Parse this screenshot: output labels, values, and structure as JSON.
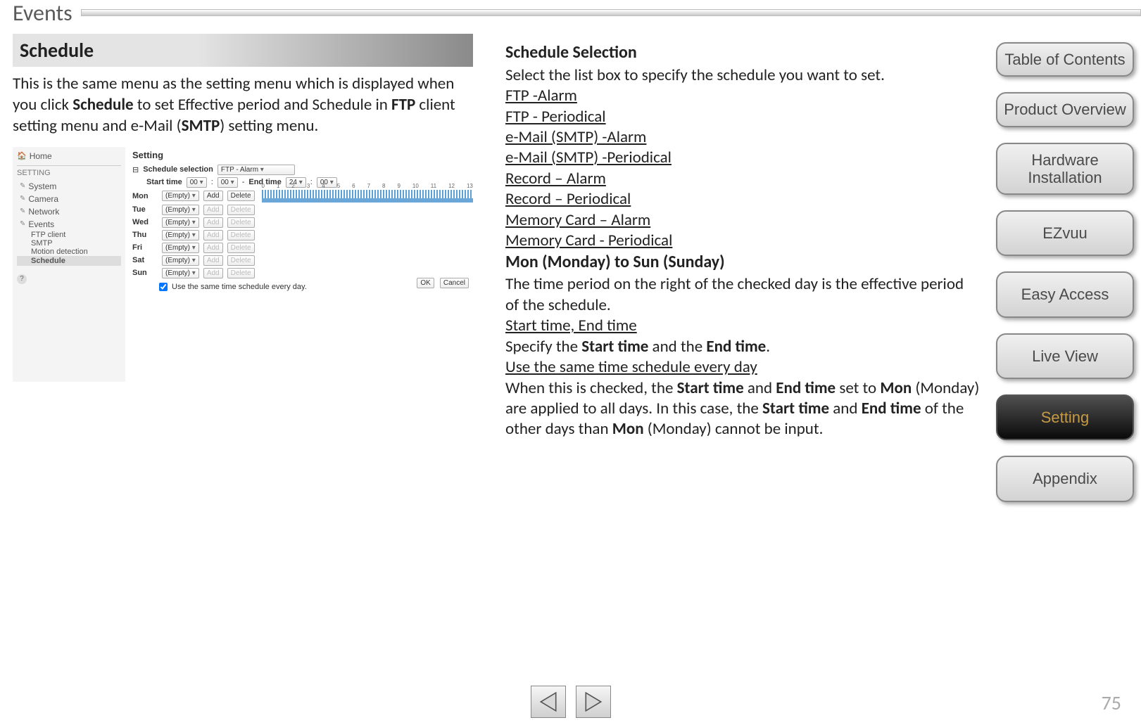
{
  "page_title": "Events",
  "section_header": "Schedule",
  "intro": {
    "p1a": "This is the same menu as the setting menu which is displayed when you click ",
    "p1b": "Schedule",
    "p1c": " to set Effective period and Schedule in ",
    "p1d": "FTP",
    "p1e": " client setting menu and e-Mail (",
    "p1f": "SMTP",
    "p1g": ") setting menu."
  },
  "screenshot": {
    "home": "Home",
    "setting_label": "SETTING",
    "items": [
      "System",
      "Camera",
      "Network",
      "Events"
    ],
    "subs": [
      "FTP client",
      "SMTP",
      "Motion detection",
      "Schedule"
    ],
    "main_title": "Setting",
    "sched_sel_label": "Schedule selection",
    "sched_sel_value": "FTP - Alarm",
    "start_label": "Start time",
    "end_label": "End time",
    "time_vals": {
      "sh": "00",
      "sm": "00",
      "eh": "24",
      "em": "00"
    },
    "days": [
      "Mon",
      "Tue",
      "Wed",
      "Thu",
      "Fri",
      "Sat",
      "Sun"
    ],
    "empty": "(Empty)",
    "add": "Add",
    "delete": "Delete",
    "ticks": [
      "0",
      "1",
      "2",
      "3",
      "4",
      "5",
      "6",
      "7",
      "8",
      "9",
      "10",
      "11",
      "12",
      "13"
    ],
    "use_same": "Use the same time schedule every day.",
    "ok": "OK",
    "cancel": "Cancel",
    "expander": "⊟"
  },
  "right": {
    "h1": "Schedule Selection",
    "p1": "Select the list box to specify the schedule you want to set.",
    "opts": [
      "FTP -Alarm",
      "FTP - Periodical",
      "e-Mail (SMTP) -Alarm",
      "e-Mail (SMTP) -Periodical",
      "Record – Alarm",
      "Record – Periodical",
      "Memory Card – Alarm",
      "Memory Card - Periodical"
    ],
    "h2": "Mon (Monday) to Sun (Sunday)",
    "p2": "The time period on the right of the checked day is the effective period of the schedule.",
    "h3": "Start time, End time",
    "p3a": "Specify the ",
    "p3b": "Start time",
    "p3c": " and the ",
    "p3d": "End time",
    "p3e": ".",
    "h4": "Use the same time schedule every day",
    "p4a": "When this is checked, the ",
    "p4b": "Start time",
    "p4c": " and ",
    "p4d": "End time",
    "p4e": " set to ",
    "p4f": "Mon",
    "p4g": " (Monday) are applied to all days. In this case, the ",
    "p4h": "Start time",
    "p4i": " and ",
    "p4j": "End time",
    "p4k": " of the other days than ",
    "p4l": "Mon",
    "p4m": " (Monday) cannot be input."
  },
  "nav": {
    "toc": "Table of Contents",
    "product": "Product Overview",
    "hardware": "Hardware Installation",
    "ezvuu": "EZvuu",
    "easy": "Easy Access",
    "live": "Live View",
    "setting": "Setting",
    "appendix": "Appendix"
  },
  "page_number": "75"
}
